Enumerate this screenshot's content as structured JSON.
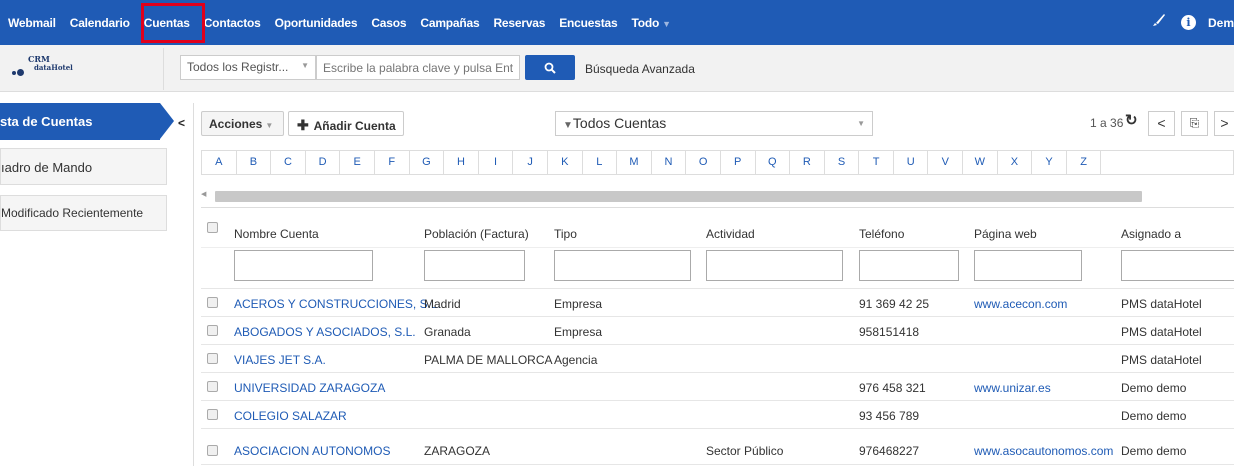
{
  "topnav": {
    "items": [
      "Webmail",
      "Calendario",
      "Cuentas",
      "Contactos",
      "Oportunidades",
      "Casos",
      "Campañas",
      "Reservas",
      "Encuestas",
      "Todo"
    ],
    "active": "Cuentas",
    "user_truncated": "Dem",
    "info_icon": "i"
  },
  "logo": {
    "line1": "CRM",
    "line2": "dataHotel"
  },
  "search": {
    "module_select": "Todos los Registr...",
    "placeholder": "Escribe la palabra clave y pulsa Enter",
    "advanced_label": "Búsqueda Avanzada"
  },
  "sidebar": {
    "items": [
      {
        "label": "sta de Cuentas",
        "active": true
      },
      {
        "label": "ıadro de Mando",
        "active": false
      },
      {
        "label": "Modificado Recientemente",
        "active": false
      }
    ]
  },
  "toolbar": {
    "toggle_icon": "<",
    "actions_label": "Acciones",
    "add_label": "Añadir Cuenta",
    "filter_label": "Todos Cuentas",
    "page_info": "1 a 36",
    "prev": "<",
    "next": ">"
  },
  "alphabet": [
    "A",
    "B",
    "C",
    "D",
    "E",
    "F",
    "G",
    "H",
    "I",
    "J",
    "K",
    "L",
    "M",
    "N",
    "O",
    "P",
    "Q",
    "R",
    "S",
    "T",
    "U",
    "V",
    "W",
    "X",
    "Y",
    "Z"
  ],
  "table": {
    "columns": [
      "Nombre Cuenta",
      "Población (Factura)",
      "Tipo",
      "Actividad",
      "Teléfono",
      "Página web",
      "Asignado a"
    ],
    "rows": [
      {
        "name": "ACEROS Y CONSTRUCCIONES, S.L.",
        "city": "Madrid",
        "type": "Empresa",
        "activity": "",
        "phone": "91 369 42 25",
        "web": "www.acecon.com",
        "assigned": "PMS dataHotel"
      },
      {
        "name": "ABOGADOS Y ASOCIADOS, S.L.",
        "city": "Granada",
        "type": "Empresa",
        "activity": "",
        "phone": "958151418",
        "web": "",
        "assigned": "PMS dataHotel"
      },
      {
        "name": "VIAJES JET S.A.",
        "city": "PALMA DE MALLORCA",
        "type": "Agencia",
        "activity": "",
        "phone": "",
        "web": "",
        "assigned": "PMS dataHotel"
      },
      {
        "name": "UNIVERSIDAD ZARAGOZA",
        "city": "",
        "type": "",
        "activity": "",
        "phone": "976 458 321",
        "web": "www.unizar.es",
        "assigned": "Demo demo"
      },
      {
        "name": "COLEGIO SALAZAR",
        "city": "",
        "type": "",
        "activity": "",
        "phone": "93 456 789",
        "web": "",
        "assigned": "Demo demo"
      },
      {
        "name": "ASOCIACION AUTONOMOS",
        "city": "ZARAGOZA",
        "type": "",
        "activity": "Sector Público",
        "phone": "976468227",
        "web": "www.asocautonomos.com",
        "assigned": "Demo demo"
      }
    ]
  },
  "colors": {
    "brand_blue": "#1f5bb5",
    "highlight_red": "#e0001b"
  }
}
